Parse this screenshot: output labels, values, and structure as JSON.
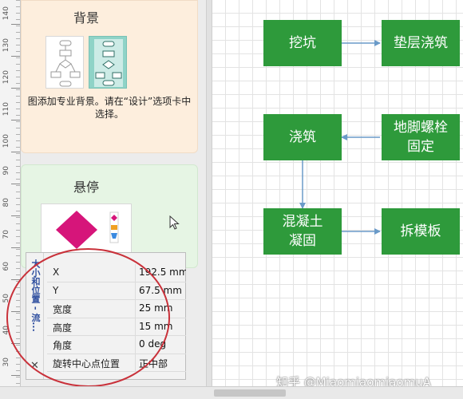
{
  "ruler": {
    "labels": [
      "140",
      "130",
      "120",
      "110",
      "100",
      "90",
      "80",
      "70",
      "60",
      "50",
      "40",
      "30"
    ]
  },
  "background_card": {
    "title": "背景",
    "description": "图添加专业背景。请在“设计”选项卡中选择。"
  },
  "hover_card": {
    "title": "悬停"
  },
  "size_position": {
    "title": "大小和位置 - 流...",
    "rows": [
      {
        "label": "X",
        "value": "192.5 mm"
      },
      {
        "label": "Y",
        "value": "67.5 mm"
      },
      {
        "label": "宽度",
        "value": "25 mm"
      },
      {
        "label": "高度",
        "value": "15 mm"
      },
      {
        "label": "角度",
        "value": "0 deg"
      },
      {
        "label": "旋转中心点位置",
        "value": "正中部"
      }
    ]
  },
  "flowchart": {
    "nodes": [
      {
        "id": "dig",
        "label": "挖坑"
      },
      {
        "id": "cushion",
        "label": "垫层浇筑"
      },
      {
        "id": "pour",
        "label": "浇筑"
      },
      {
        "id": "bolt",
        "label": "地脚螺栓固定"
      },
      {
        "id": "cure",
        "label": "混凝土凝固"
      },
      {
        "id": "formwork",
        "label": "拆模板"
      }
    ],
    "colors": {
      "node_fill": "#2e9a3b",
      "node_text": "#ffffff",
      "arrow": "#6a9ac8"
    }
  },
  "watermark": "知乎 @MiaomiaomiaomuA"
}
